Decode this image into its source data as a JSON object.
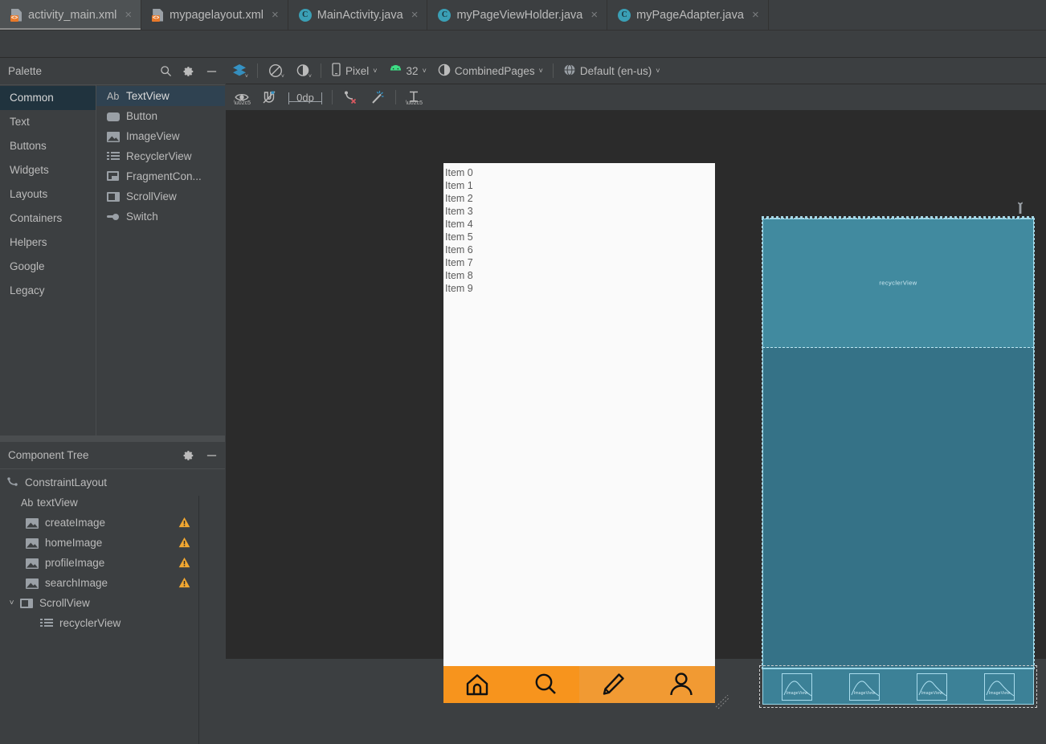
{
  "window": {
    "tabs": [
      {
        "label": "activity_main.xml",
        "icon": "xml-file-icon",
        "active": true,
        "closable": true
      },
      {
        "label": "mypagelayout.xml",
        "icon": "xml-file-icon",
        "active": false,
        "closable": true
      },
      {
        "label": "MainActivity.java",
        "icon": "java-class-icon",
        "active": false,
        "closable": true
      },
      {
        "label": "myPageViewHolder.java",
        "icon": "java-class-icon",
        "active": false,
        "closable": true
      },
      {
        "label": "myPageAdapter.java",
        "icon": "java-class-icon",
        "active": false,
        "closable": true
      }
    ],
    "close_glyph": "×"
  },
  "palette": {
    "title": "Palette",
    "header_icons": [
      "search-icon",
      "gear-icon",
      "minimize-icon"
    ],
    "groups": [
      {
        "label": "Common",
        "selected": true
      },
      {
        "label": "Text",
        "selected": false
      },
      {
        "label": "Buttons",
        "selected": false
      },
      {
        "label": "Widgets",
        "selected": false
      },
      {
        "label": "Layouts",
        "selected": false
      },
      {
        "label": "Containers",
        "selected": false
      },
      {
        "label": "Helpers",
        "selected": false
      },
      {
        "label": "Google",
        "selected": false
      },
      {
        "label": "Legacy",
        "selected": false
      }
    ],
    "items": [
      {
        "label": "TextView",
        "icon": "textview-icon",
        "selected": true
      },
      {
        "label": "Button",
        "icon": "button-icon",
        "selected": false
      },
      {
        "label": "ImageView",
        "icon": "imageview-icon",
        "selected": false
      },
      {
        "label": "RecyclerView",
        "icon": "recyclerview-icon",
        "selected": false
      },
      {
        "label": "FragmentCon...",
        "icon": "fragment-container-icon",
        "selected": false
      },
      {
        "label": "ScrollView",
        "icon": "scrollview-icon",
        "selected": false
      },
      {
        "label": "Switch",
        "icon": "switch-icon",
        "selected": false
      }
    ]
  },
  "component_tree": {
    "title": "Component Tree",
    "header_icons": [
      "gear-icon",
      "minimize-icon"
    ],
    "nodes": [
      {
        "label": "ConstraintLayout",
        "icon": "constraintlayout-icon",
        "depth": 0,
        "warning": false,
        "chevron": ""
      },
      {
        "label": "textView",
        "icon": "textview-icon",
        "depth": 1,
        "warning": false,
        "chevron": ""
      },
      {
        "label": "createImage",
        "icon": "imageview-icon",
        "depth": 1,
        "warning": true,
        "chevron": ""
      },
      {
        "label": "homeImage",
        "icon": "imageview-icon",
        "depth": 1,
        "warning": true,
        "chevron": ""
      },
      {
        "label": "profileImage",
        "icon": "imageview-icon",
        "depth": 1,
        "warning": true,
        "chevron": ""
      },
      {
        "label": "searchImage",
        "icon": "imageview-icon",
        "depth": 1,
        "warning": true,
        "chevron": ""
      },
      {
        "label": "ScrollView",
        "icon": "scrollview-icon",
        "depth": 0,
        "warning": false,
        "chevron": "˅"
      },
      {
        "label": "recyclerView",
        "icon": "recyclerview-icon",
        "depth": 2,
        "warning": false,
        "chevron": ""
      }
    ]
  },
  "toolbar_primary": {
    "design_mode": {
      "label": "",
      "icon": "layers-icon"
    },
    "orientation": {
      "label": "",
      "icon": "rotate-device-icon"
    },
    "theme": {
      "label": "",
      "icon": "theme-contrast-icon"
    },
    "device": {
      "label": "Pixel",
      "icon": "phone-icon"
    },
    "api_level": {
      "label": "32",
      "icon": "android-robot-icon"
    },
    "app_theme": {
      "label": "CombinedPages",
      "icon": "theme-circle-icon"
    },
    "locale": {
      "label": "Default (en-us)",
      "icon": "globe-icon"
    },
    "caret": "˅"
  },
  "toolbar_secondary": {
    "visibility": {
      "label": "",
      "icon": "eye-icon"
    },
    "autoconnect": {
      "label": "",
      "icon": "magnet-off-icon"
    },
    "default_margin": {
      "label": "0dp",
      "icon": "margin-icon"
    },
    "clear_constraints": {
      "label": "",
      "icon": "clear-constraints-icon"
    },
    "infer_constraints": {
      "label": "",
      "icon": "magic-wand-icon"
    },
    "guidelines": {
      "label": "",
      "icon": "guidelines-icon"
    }
  },
  "preview": {
    "wrench_icon": "wrench-icon",
    "list_items": [
      "Item 0",
      "Item 1",
      "Item 2",
      "Item 3",
      "Item 4",
      "Item 5",
      "Item 6",
      "Item 7",
      "Item 8",
      "Item 9"
    ],
    "bottom_nav": [
      {
        "name": "home",
        "icon": "home-icon",
        "tinted": false
      },
      {
        "name": "search",
        "icon": "search-icon",
        "tinted": false
      },
      {
        "name": "create",
        "icon": "pencil-icon",
        "tinted": true
      },
      {
        "name": "profile",
        "icon": "person-icon",
        "tinted": true
      }
    ],
    "nav_background_color": "#f7941d",
    "background_color": "#fafafa"
  },
  "blueprint": {
    "wrench_icon": "wrench-icon",
    "recycler_label": "recyclerView",
    "bottom_images": [
      "ImageView",
      "ImageView",
      "ImageView",
      "ImageView"
    ],
    "fill_color": "#3c8197",
    "recycler_color": "#418a9f",
    "stroke_color": "#9bd7e8"
  },
  "colors": {
    "panel_bg": "#3c3f41",
    "canvas_bg": "#2b2b2b",
    "selection_blue": "#2f4251",
    "group_selection": "#20333e",
    "accent_orange": "#f7941d",
    "warning_amber": "#f0a732",
    "text": "#bbbbbb"
  }
}
